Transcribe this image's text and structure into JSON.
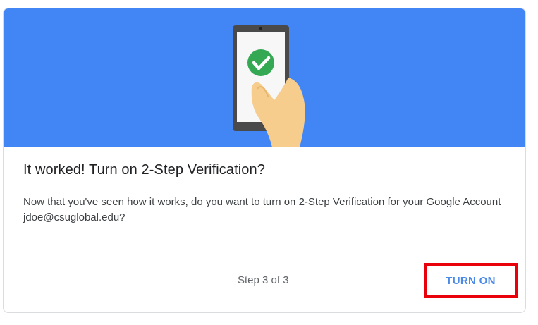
{
  "dialog": {
    "title": "It worked! Turn on 2-Step Verification?",
    "description": "Now that you've seen how it works, do you want to turn on 2-Step Verification for your Google Account jdoe@csuglobal.edu?",
    "step_indicator": "Step 3 of 3",
    "primary_button_label": "TURN ON"
  },
  "illustration": {
    "icon": "phone-checkmark-icon",
    "background_color": "#4285f4"
  },
  "colors": {
    "button_text": "#4c8ae8",
    "highlight_border": "#e8000b",
    "check_green": "#34a853"
  }
}
